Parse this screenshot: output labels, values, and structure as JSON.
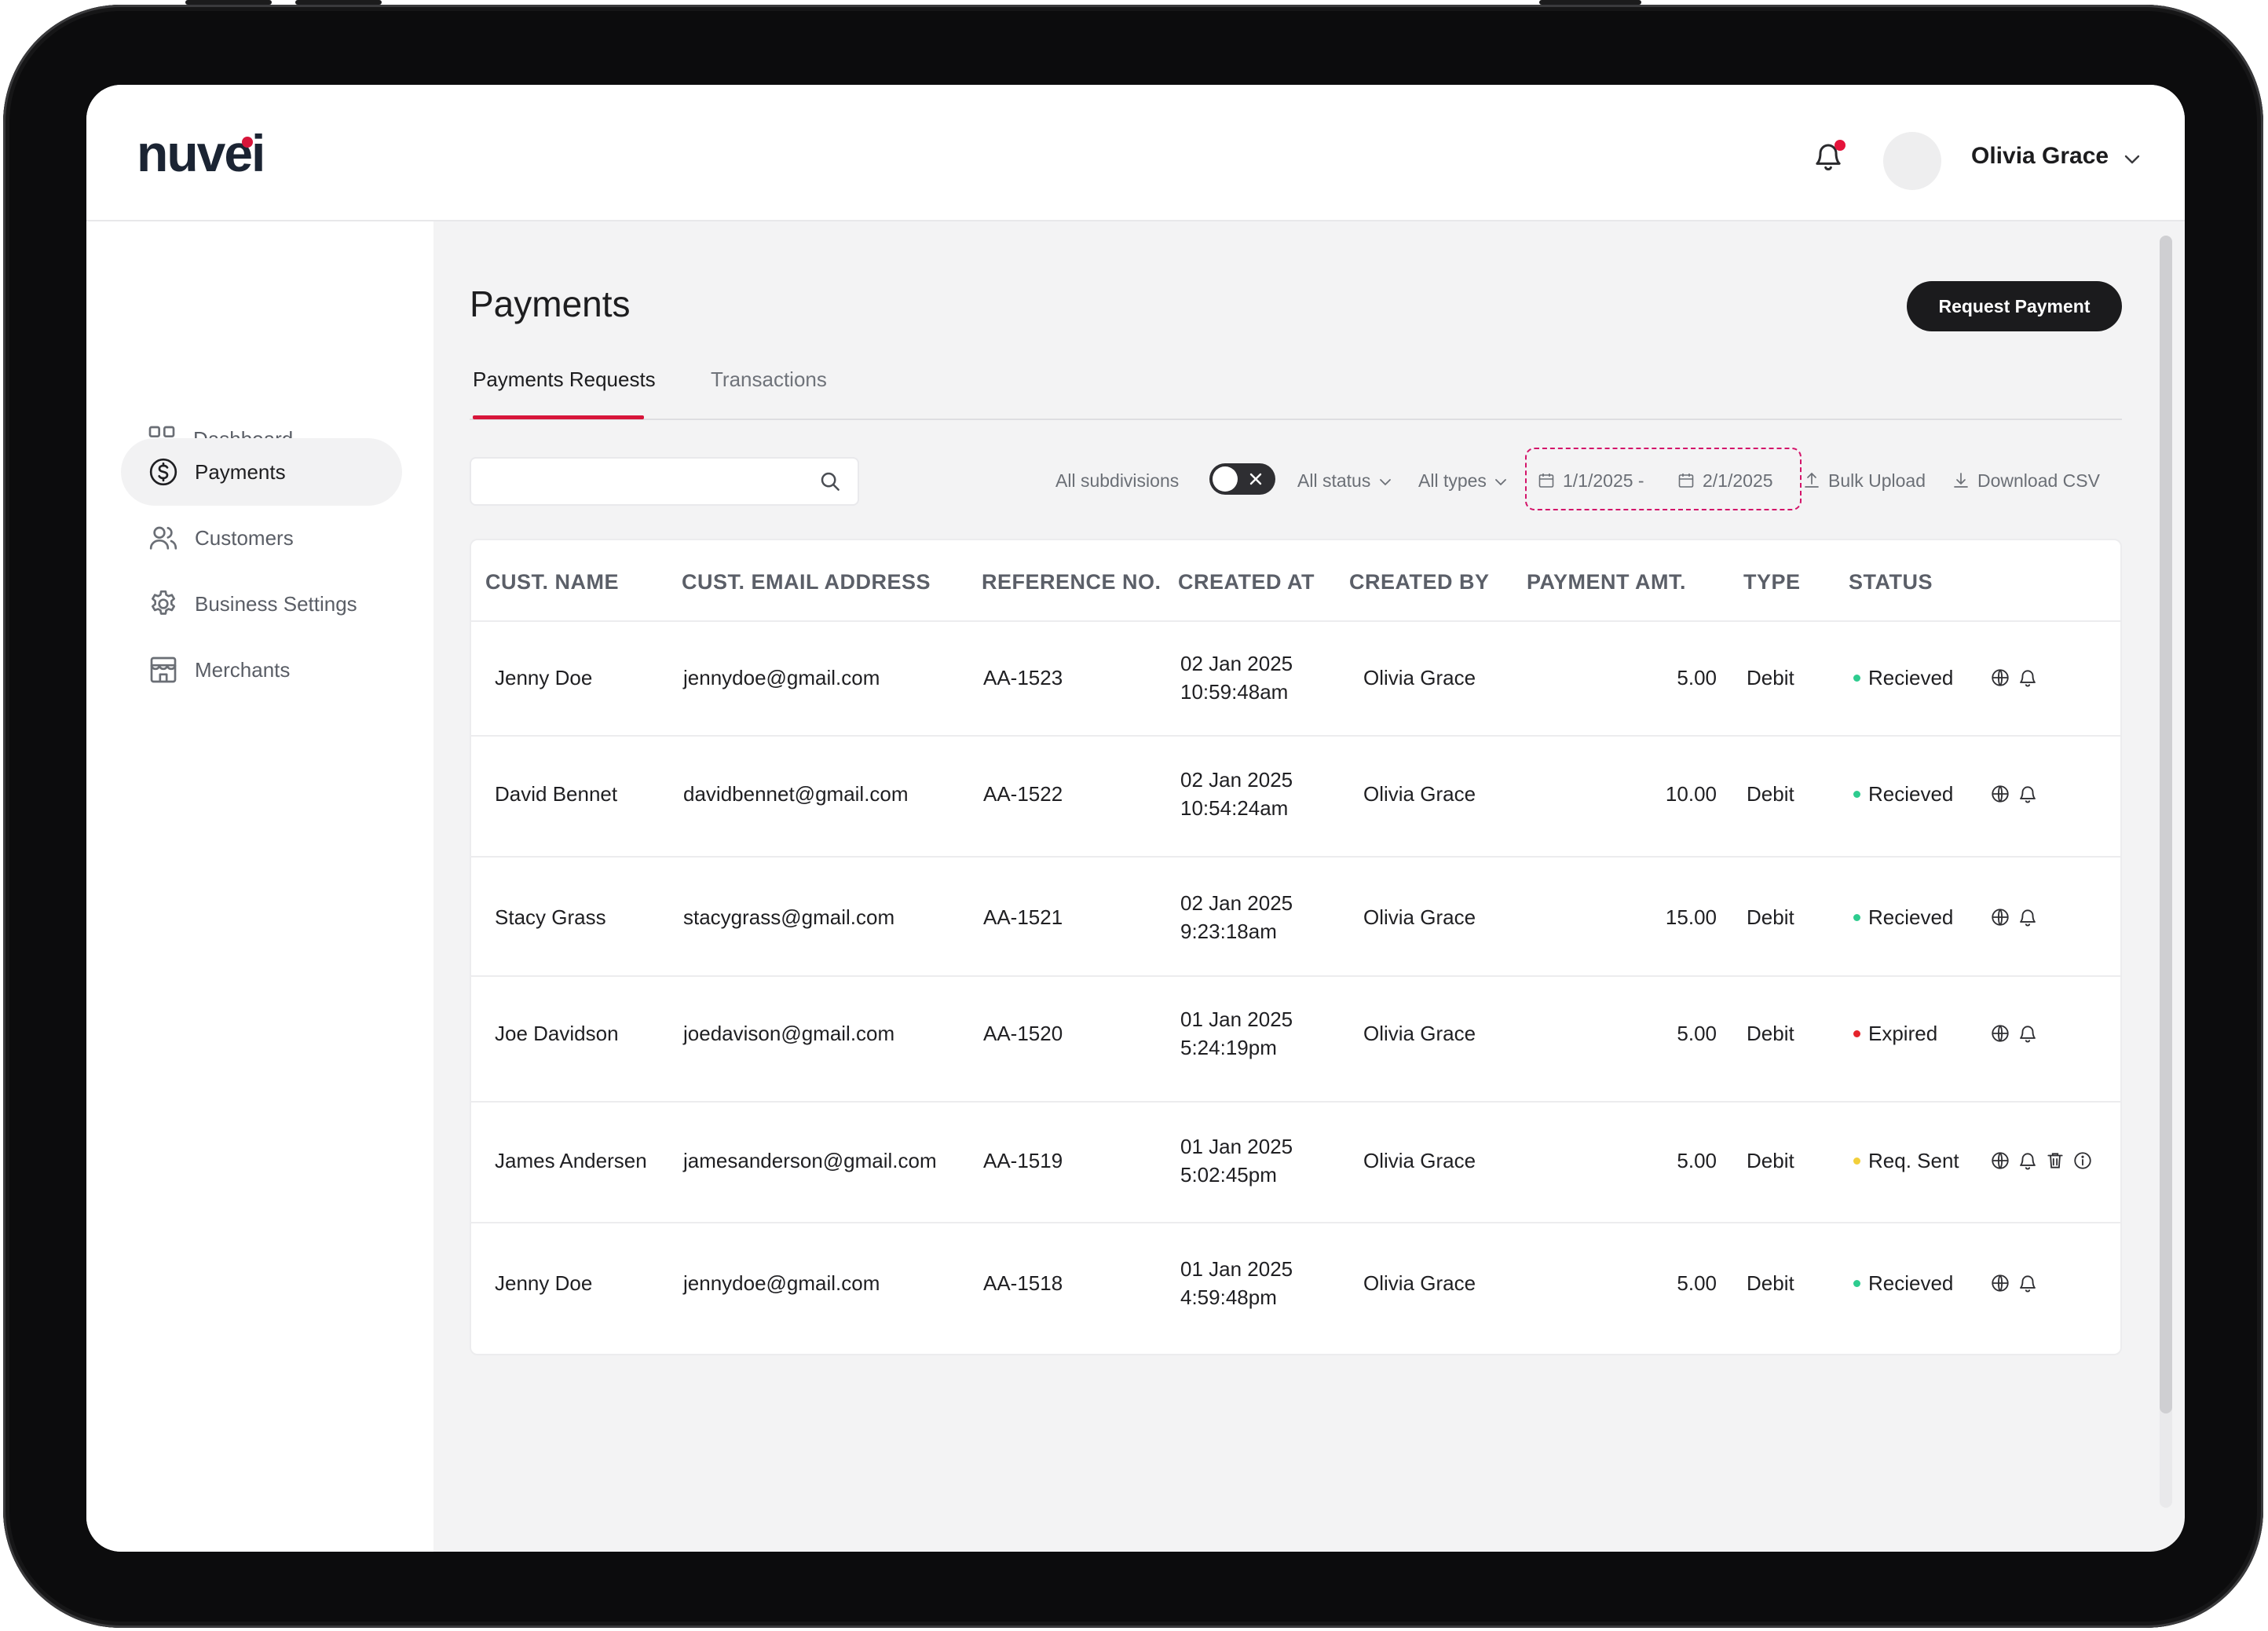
{
  "brand": {
    "logo_text": "nuvei",
    "accent": "#d7153a"
  },
  "header": {
    "user_name": "Olivia Grace",
    "notification_icon": "bell-icon"
  },
  "sidebar": {
    "items": [
      {
        "label": "Dashboard",
        "icon": "grid-icon",
        "active": false
      },
      {
        "label": "Payments",
        "icon": "dollar-circle-icon",
        "active": true
      },
      {
        "label": "Customers",
        "icon": "users-icon",
        "active": false
      },
      {
        "label": "Business Settings",
        "icon": "gear-icon",
        "active": false
      },
      {
        "label": "Merchants",
        "icon": "store-icon",
        "active": false
      }
    ]
  },
  "main": {
    "title": "Payments",
    "request_button": "Request Payment",
    "tabs": [
      {
        "label": "Payments Requests",
        "active": true
      },
      {
        "label": "Transactions",
        "active": false
      }
    ]
  },
  "filters": {
    "search_placeholder": "",
    "subdivisions_label": "All subdivisions",
    "status_label": "All status",
    "types_label": "All types",
    "date_from": "1/1/2025 -",
    "date_to": "2/1/2025",
    "bulk_upload": "Bulk Upload",
    "download_csv": "Download CSV"
  },
  "table": {
    "headers": [
      "CUST. NAME",
      "CUST. EMAIL ADDRESS",
      "REFERENCE NO.",
      "CREATED AT",
      "CREATED BY",
      "PAYMENT AMT.",
      "TYPE",
      "STATUS"
    ],
    "rows": [
      {
        "name": "Jenny Doe",
        "email": "jennydoe@gmail.com",
        "ref": "AA-1523",
        "date": "02 Jan 2025",
        "time": "10:59:48am",
        "by": "Olivia Grace",
        "amount": "5.00",
        "type": "Debit",
        "status": "Recieved",
        "status_color": "#2ecc8f",
        "actions": [
          "globe-icon",
          "bell-icon"
        ]
      },
      {
        "name": "David Bennet",
        "email": "davidbennet@gmail.com",
        "ref": "AA-1522",
        "date": "02 Jan 2025",
        "time": "10:54:24am",
        "by": "Olivia Grace",
        "amount": "10.00",
        "type": "Debit",
        "status": "Recieved",
        "status_color": "#2ecc8f",
        "actions": [
          "globe-icon",
          "bell-icon"
        ]
      },
      {
        "name": "Stacy Grass",
        "email": "stacygrass@gmail.com",
        "ref": "AA-1521",
        "date": "02 Jan 2025",
        "time": "9:23:18am",
        "by": "Olivia Grace",
        "amount": "15.00",
        "type": "Debit",
        "status": "Recieved",
        "status_color": "#2ecc8f",
        "actions": [
          "globe-icon",
          "bell-icon"
        ]
      },
      {
        "name": "Joe Davidson",
        "email": "joedavison@gmail.com",
        "ref": "AA-1520",
        "date": "01 Jan 2025",
        "time": "5:24:19pm",
        "by": "Olivia Grace",
        "amount": "5.00",
        "type": "Debit",
        "status": "Expired",
        "status_color": "#e5242b",
        "actions": [
          "globe-icon",
          "bell-icon"
        ]
      },
      {
        "name": "James Andersen",
        "email": "jamesanderson@gmail.com",
        "ref": "AA-1519",
        "date": "01 Jan 2025",
        "time": "5:02:45pm",
        "by": "Olivia Grace",
        "amount": "5.00",
        "type": "Debit",
        "status": "Req. Sent",
        "status_color": "#f2cf3a",
        "actions": [
          "globe-icon",
          "bell-icon",
          "trash-icon",
          "info-icon"
        ]
      },
      {
        "name": "Jenny Doe",
        "email": "jennydoe@gmail.com",
        "ref": "AA-1518",
        "date": "01 Jan 2025",
        "time": "4:59:48pm",
        "by": "Olivia Grace",
        "amount": "5.00",
        "type": "Debit",
        "status": "Recieved",
        "status_color": "#2ecc8f",
        "actions": [
          "globe-icon",
          "bell-icon"
        ]
      }
    ]
  }
}
